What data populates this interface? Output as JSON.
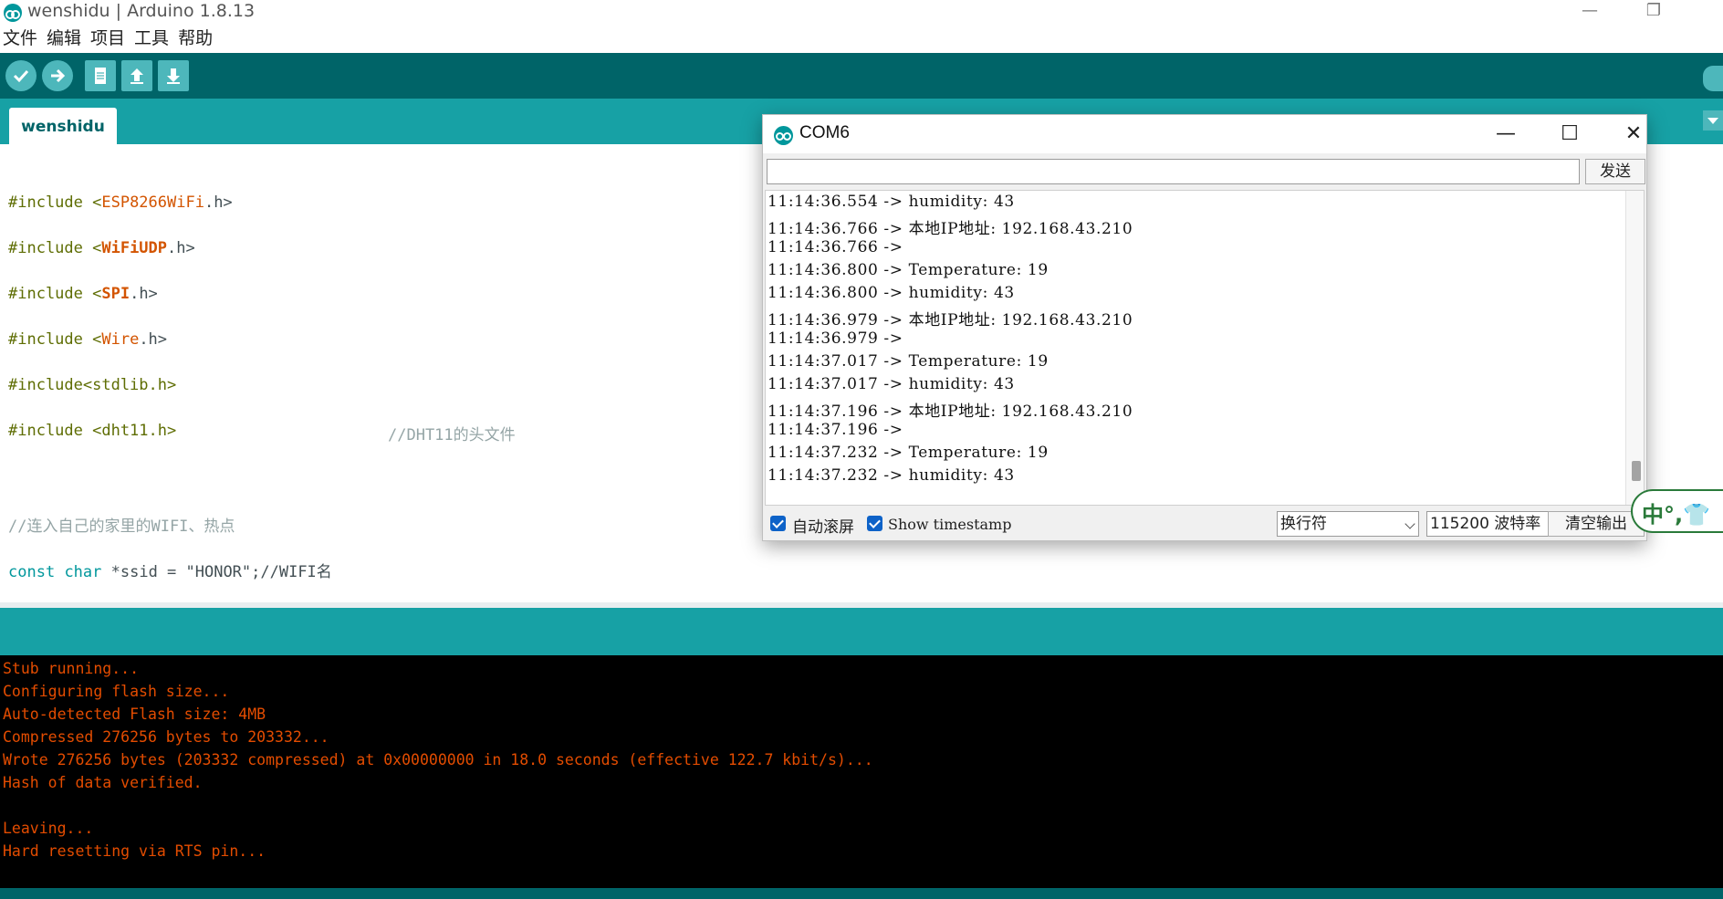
{
  "window": {
    "title": "wenshidu | Arduino 1.8.13",
    "minimize": "—",
    "restore": "❐"
  },
  "menu": [
    "文件",
    "编辑",
    "项目",
    "工具",
    "帮助"
  ],
  "toolbar": {
    "buttons": [
      "verify",
      "upload",
      "new",
      "open",
      "save"
    ],
    "icons": [
      "checkmark-icon",
      "arrow-right-icon",
      "file-icon",
      "arrow-up-icon",
      "arrow-down-icon"
    ]
  },
  "tab": {
    "label": "wenshidu"
  },
  "editor": {
    "lines": [
      {
        "pre": "#include <",
        "name": "ESP8266WiFi",
        "post": ".h>",
        "style": "lib"
      },
      {
        "pre": "#include <",
        "name": "WiFiUDP",
        "post": ".h>",
        "style": "libb"
      },
      {
        "pre": "#include <",
        "name": "SPI",
        "post": ".h>",
        "style": "libb"
      },
      {
        "pre": "#include <",
        "name": "Wire",
        "post": ".h>",
        "style": "lib"
      },
      {
        "pre": "#include<stdlib.h>",
        "name": "",
        "post": "",
        "style": ""
      },
      {
        "pre": "#include <dht11.h>",
        "name": "",
        "post": "",
        "style": ""
      }
    ],
    "dht_comment": "//DHT11的头文件",
    "wifi_comment": "//连入自己的家里的WIFI、热点",
    "ssid_line": {
      "kw1": "const",
      "kw2": "char",
      "rest": " *ssid = \"HONOR\";//WIFI名"
    }
  },
  "console": {
    "lines": [
      "Stub running...",
      "Configuring flash size...",
      "Auto-detected Flash size: 4MB",
      "Compressed 276256 bytes to 203332...",
      "Wrote 276256 bytes (203332 compressed) at 0x00000000 in 18.0 seconds (effective 122.7 kbit/s)...",
      "Hash of data verified.",
      "",
      "Leaving...",
      "Hard resetting via RTS pin..."
    ]
  },
  "serial_monitor": {
    "title": "COM6",
    "minimize": "—",
    "maximize": "☐",
    "close": "✕",
    "send_label": "发送",
    "input_value": "",
    "output": [
      "11:14:36.554 -> humidity: 43",
      "11:14:36.766 -> 本地IP地址: 192.168.43.210",
      "11:14:36.766 ->",
      "11:14:36.800 -> Temperature: 19",
      "11:14:36.800 -> humidity: 43",
      "11:14:36.979 -> 本地IP地址: 192.168.43.210",
      "11:14:36.979 ->",
      "11:14:37.017 -> Temperature: 19",
      "11:14:37.017 -> humidity: 43",
      "11:14:37.196 -> 本地IP地址: 192.168.43.210",
      "11:14:37.196 ->",
      "11:14:37.232 -> Temperature: 19",
      "11:14:37.232 -> humidity: 43"
    ],
    "autoscroll_label": "自动滚屏",
    "autoscroll_checked": true,
    "timestamp_label": "Show timestamp",
    "timestamp_checked": true,
    "line_ending": "换行符",
    "baud_rate": "115200 波特率",
    "clear_label": "清空输出"
  },
  "ime": {
    "text": "中°,👕"
  },
  "colors": {
    "toolbar": "#006468",
    "tabbar": "#17a1a5",
    "console_text": "#e34c00",
    "accent": "#00979c"
  }
}
